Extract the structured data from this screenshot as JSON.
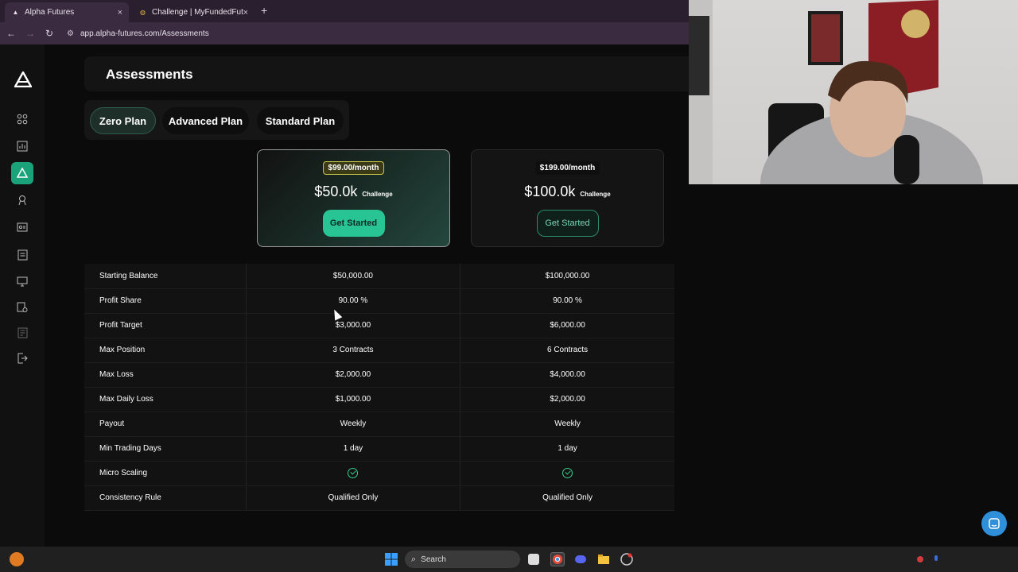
{
  "browser": {
    "tabs": [
      {
        "title": "Alpha Futures",
        "favicon": "alpha-logo",
        "active": true
      },
      {
        "title": "Challenge | MyFundedFutures",
        "favicon": "mff-logo",
        "active": false
      }
    ],
    "new_tab_symbol": "+",
    "close_symbol": "×",
    "url": "app.alpha-futures.com/Assessments"
  },
  "page": {
    "title": "Assessments",
    "plans": [
      {
        "label": "Zero Plan",
        "active": true
      },
      {
        "label": "Advanced Plan",
        "active": false
      },
      {
        "label": "Standard Plan",
        "active": false
      }
    ]
  },
  "cards": [
    {
      "price": "$99.00/month",
      "size": "$50.0k",
      "tag": "Challenge",
      "cta": "Get Started",
      "featured": true
    },
    {
      "price": "$199.00/month",
      "size": "$100.0k",
      "tag": "Challenge",
      "cta": "Get Started",
      "featured": false
    }
  ],
  "specs": {
    "rows": [
      {
        "label": "Starting Balance",
        "values": [
          "$50,000.00",
          "$100,000.00"
        ]
      },
      {
        "label": "Profit Share",
        "values": [
          "90.00 %",
          "90.00 %"
        ]
      },
      {
        "label": "Profit Target",
        "values": [
          "$3,000.00",
          "$6,000.00"
        ]
      },
      {
        "label": "Max Position",
        "values": [
          "3 Contracts",
          "6 Contracts"
        ]
      },
      {
        "label": "Max Loss",
        "values": [
          "$2,000.00",
          "$4,000.00"
        ]
      },
      {
        "label": "Max Daily Loss",
        "values": [
          "$1,000.00",
          "$2,000.00"
        ]
      },
      {
        "label": "Payout",
        "values": [
          "Weekly",
          "Weekly"
        ]
      },
      {
        "label": "Min Trading Days",
        "values": [
          "1 day",
          "1 day"
        ]
      },
      {
        "label": "Micro Scaling",
        "values": [
          "check",
          "check"
        ]
      },
      {
        "label": "Consistency Rule",
        "values": [
          "Qualified Only",
          "Qualified Only"
        ]
      }
    ]
  },
  "taskbar": {
    "search_placeholder": "Search"
  },
  "colors": {
    "accent": "#1aa37a",
    "cta": "#28c493",
    "badge_border": "#c9c64a",
    "check": "#36d28f"
  }
}
